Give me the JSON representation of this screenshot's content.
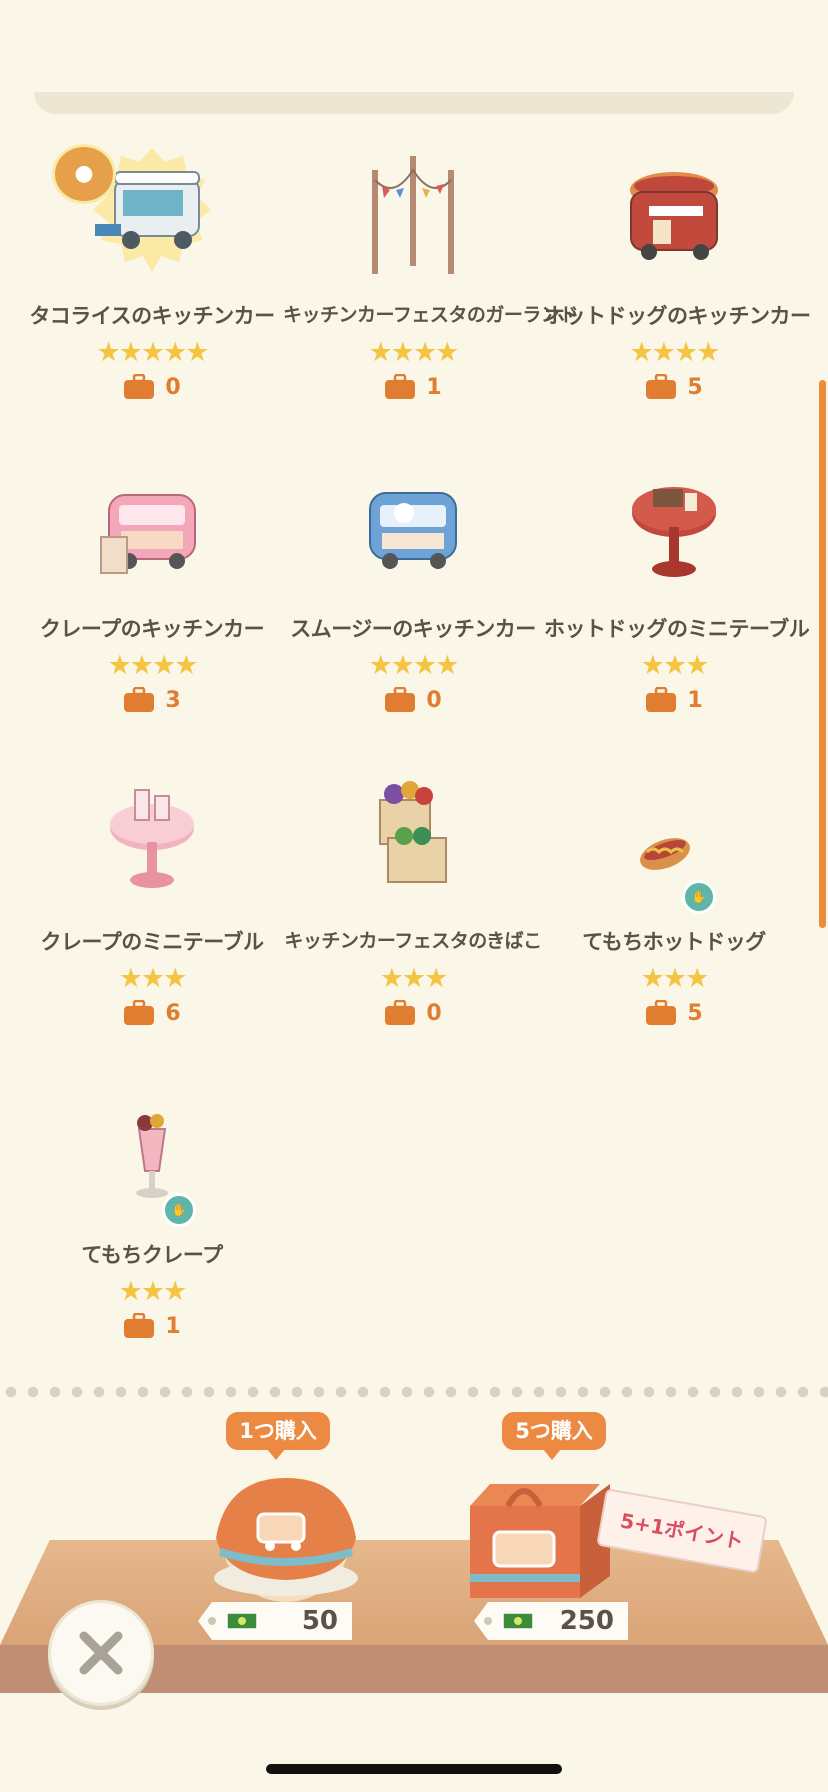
{
  "items": [
    {
      "name": "タコライスのキッチンカー",
      "stars": "★★★★★",
      "owned": "0",
      "thumb": "taco-rice-kitchen-car"
    },
    {
      "name": "キッチンカーフェスタのガーランド",
      "stars": "★★★★",
      "owned": "1",
      "thumb": "kitchen-car-festa-garland"
    },
    {
      "name": "ホットドッグのキッチンカー",
      "stars": "★★★★",
      "owned": "5",
      "thumb": "hot-dog-kitchen-car"
    },
    {
      "name": "クレープのキッチンカー",
      "stars": "★★★★",
      "owned": "3",
      "thumb": "crepe-kitchen-car"
    },
    {
      "name": "スムージーのキッチンカー",
      "stars": "★★★★",
      "owned": "0",
      "thumb": "smoothie-kitchen-car"
    },
    {
      "name": "ホットドッグのミニテーブル",
      "stars": "★★★",
      "owned": "1",
      "thumb": "hot-dog-mini-table"
    },
    {
      "name": "クレープのミニテーブル",
      "stars": "★★★",
      "owned": "6",
      "thumb": "crepe-mini-table"
    },
    {
      "name": "キッチンカーフェスタのきばこ",
      "stars": "★★★",
      "owned": "0",
      "thumb": "kitchen-car-festa-wooden-box"
    },
    {
      "name": "てもちホットドッグ",
      "stars": "★★★",
      "owned": "5",
      "thumb": "handheld-hot-dog"
    },
    {
      "name": "てもちクレープ",
      "stars": "★★★",
      "owned": "1",
      "thumb": "handheld-crepe"
    }
  ],
  "store": {
    "buy_one": {
      "label": "1つ購入",
      "price": "50"
    },
    "buy_five": {
      "label": "5つ購入",
      "price": "250",
      "bonus": "5+1ポイント"
    }
  },
  "icons": {
    "owned": "suitcase-icon",
    "currency": "leaf-ticket-icon",
    "close": "close-icon",
    "handheld": "hand-badge-icon"
  },
  "colors": {
    "background": "#faf7e9",
    "star": "#f6c443",
    "accent": "#ec8a43",
    "scrollbar": "#ec8d3a"
  }
}
